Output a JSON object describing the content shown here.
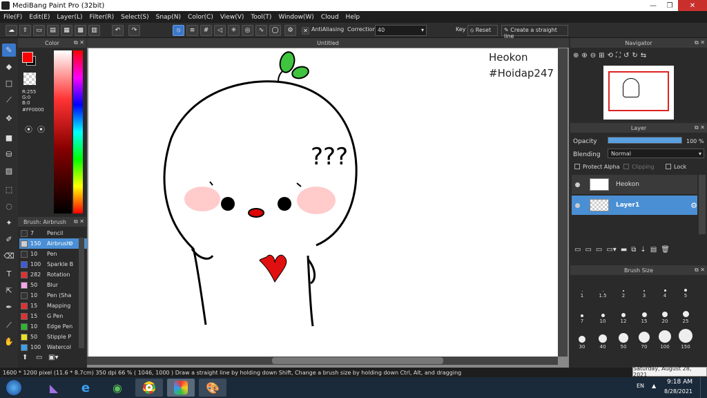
{
  "window": {
    "title": "MediBang Paint Pro (32bit)",
    "min": "—",
    "restore": "❐",
    "close": "✕"
  },
  "menu": [
    "File(F)",
    "Edit(E)",
    "Layer(L)",
    "Filter(R)",
    "Select(S)",
    "Snap(N)",
    "Color(C)",
    "View(V)",
    "Tool(T)",
    "Window(W)",
    "Cloud",
    "Help"
  ],
  "toolbar": {
    "antialias_label": "AntiAliasing",
    "correction_label": "Correction",
    "correction_value": "40",
    "key_label": "Key",
    "reset_label": "Reset",
    "straight_line_label": "Create a straight line"
  },
  "color_panel": {
    "title": "Color",
    "r": "R:255",
    "g": "G:0",
    "b": "B:0",
    "hex": "#FF0000",
    "fg": "#FF0000",
    "bg": "#000000"
  },
  "brush_panel": {
    "title": "Brush: Airbrush",
    "brushes": [
      {
        "size": "7",
        "name": "Pencil",
        "color": "#333333"
      },
      {
        "size": "150",
        "name": "Airbrush",
        "color": "#cfcfcf",
        "selected": true
      },
      {
        "size": "10",
        "name": "Pen",
        "color": "#333333"
      },
      {
        "size": "100",
        "name": "Sparkle B",
        "color": "#3a5bd9"
      },
      {
        "size": "282",
        "name": "Rotation",
        "color": "#e03030"
      },
      {
        "size": "50",
        "name": "Blur",
        "color": "#f4a6e8"
      },
      {
        "size": "10",
        "name": "Pen (Sha",
        "color": "#333333"
      },
      {
        "size": "15",
        "name": "Mapping",
        "color": "#e03030"
      },
      {
        "size": "15",
        "name": "G Pen",
        "color": "#e03030"
      },
      {
        "size": "10",
        "name": "Edge Pen",
        "color": "#2db52d"
      },
      {
        "size": "50",
        "name": "Stipple P",
        "color": "#e8e020"
      },
      {
        "size": "100",
        "name": "Watercol",
        "color": "#3aa0e8"
      }
    ]
  },
  "canvas": {
    "tab_title": "Untitled",
    "watermark_line1": "Heokon",
    "watermark_line2": "#Hoidap247",
    "doodle_text": "???"
  },
  "navigator": {
    "title": "Navigator"
  },
  "layer_panel": {
    "title": "Layer",
    "opacity_label": "Opacity",
    "opacity_value": "100 %",
    "opacity_fraction": 1.0,
    "blending_label": "Blending",
    "blending_value": "Normal",
    "protect_alpha": "Protect Alpha",
    "clipping": "Clipping",
    "lock": "Lock",
    "layers": [
      {
        "name": "Heokon",
        "selected": false
      },
      {
        "name": "Layer1",
        "selected": true
      }
    ]
  },
  "brush_size": {
    "title": "Brush Size",
    "sizes": [
      "1",
      "1.5",
      "2",
      "3",
      "4",
      "5",
      "7",
      "10",
      "12",
      "15",
      "20",
      "25",
      "30",
      "40",
      "50",
      "70",
      "100",
      "150"
    ]
  },
  "status": {
    "text": "1600 * 1200 pixel  (11.6 * 8.7cm)  350 dpi  66 %  ( 1046, 1000 )  Draw a straight line by holding down Shift, Change a brush size by holding down Ctrl, Alt, and dragging",
    "tooltip": "Saturday, August 28, 2021"
  },
  "taskbar": {
    "lang": "EN",
    "time": "9:18 AM",
    "date": "8/28/2021"
  }
}
